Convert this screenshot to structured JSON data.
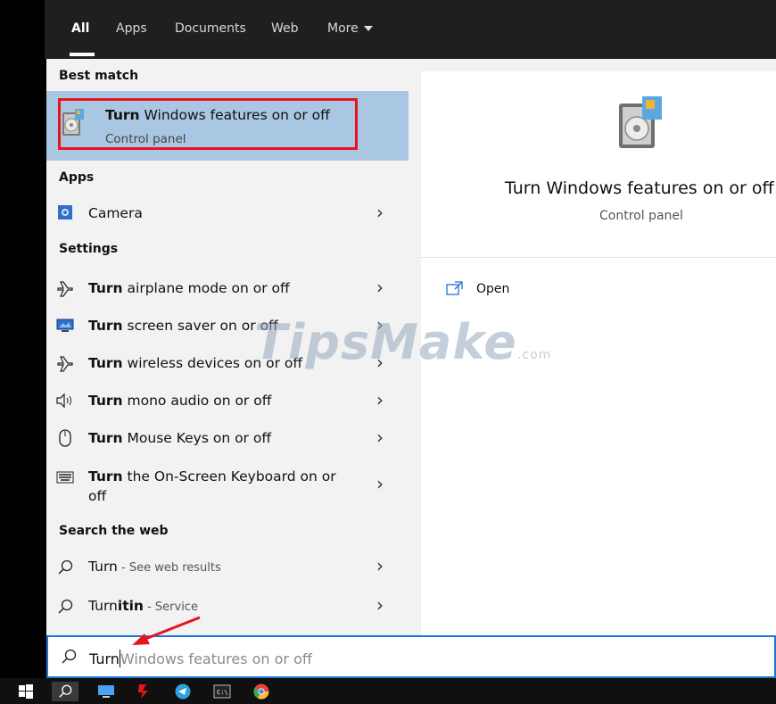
{
  "tabs": [
    {
      "label": "All"
    },
    {
      "label": "Apps"
    },
    {
      "label": "Documents"
    },
    {
      "label": "Web"
    },
    {
      "label": "More"
    }
  ],
  "sections": {
    "best_match": "Best match",
    "apps": "Apps",
    "settings": "Settings",
    "search_web": "Search the web"
  },
  "best_match": {
    "title_bold": "Turn",
    "title_rest": " Windows features on or off",
    "subtitle": "Control panel"
  },
  "apps": [
    {
      "label": "Camera"
    }
  ],
  "settings": [
    {
      "bold": "Turn",
      "rest": " airplane mode on or off",
      "icon": "airplane-icon"
    },
    {
      "bold": "Turn",
      "rest": " screen saver on or off",
      "icon": "monitor-icon"
    },
    {
      "bold": "Turn",
      "rest": " wireless devices on or off",
      "icon": "airplane-icon"
    },
    {
      "bold": "Turn",
      "rest": " mono audio on or off",
      "icon": "speaker-icon"
    },
    {
      "bold": "Turn",
      "rest": " Mouse Keys on or off",
      "icon": "mouse-icon"
    },
    {
      "bold": "Turn",
      "rest": " the On-Screen Keyboard on or off",
      "icon": "keyboard-icon"
    }
  ],
  "web": [
    {
      "bold": "Turn",
      "rest": "",
      "suffix": " - See web results"
    },
    {
      "bold": "Turnitin",
      "rest": "",
      "suffix": " - Service"
    }
  ],
  "detail": {
    "title": "Turn Windows features on or off",
    "subtitle": "Control panel",
    "open_label": "Open"
  },
  "search": {
    "typed": "Turn",
    "suggestion": "Windows features on or off"
  },
  "watermark": {
    "main": "TipsMake",
    "suffix": ".com"
  },
  "colors": {
    "accent": "#1e74d4",
    "highlight": "#a9c7e2",
    "annotation_red": "#e8141c"
  }
}
